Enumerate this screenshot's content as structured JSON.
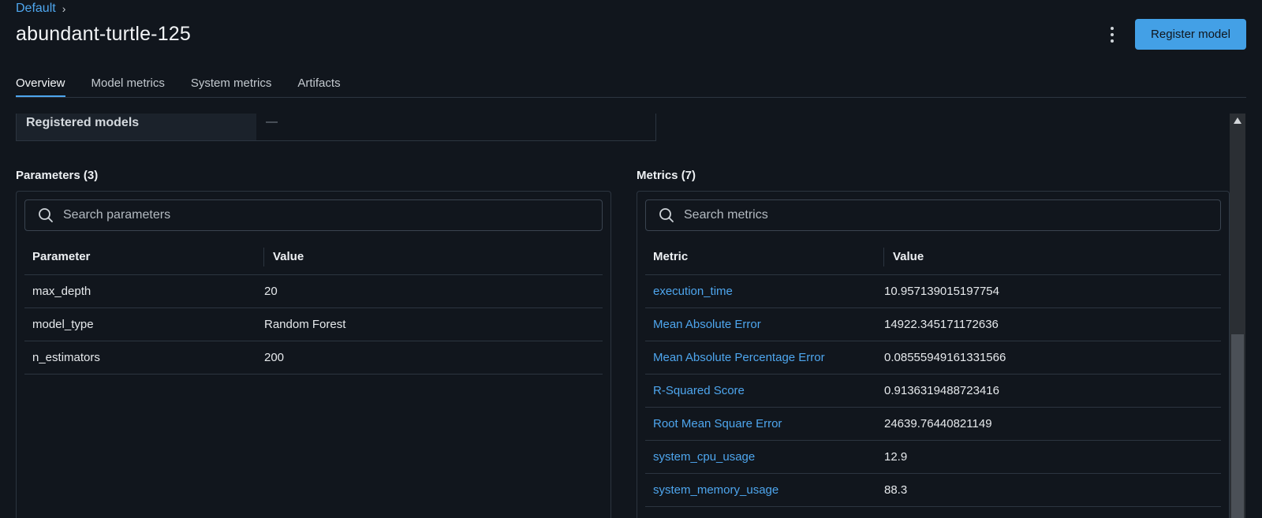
{
  "breadcrumb": {
    "link": "Default",
    "separator": "›"
  },
  "run_title": "abundant-turtle-125",
  "header": {
    "register_label": "Register model",
    "more_icon": "kebab-vertical-icon"
  },
  "tabs": [
    {
      "label": "Overview",
      "active": true
    },
    {
      "label": "Model metrics",
      "active": false
    },
    {
      "label": "System metrics",
      "active": false
    },
    {
      "label": "Artifacts",
      "active": false
    }
  ],
  "details": {
    "registered_models_label": "Registered models",
    "registered_models_value": "—"
  },
  "parameters": {
    "title": "Parameters (3)",
    "search_placeholder": "Search parameters",
    "col_name": "Parameter",
    "col_value": "Value",
    "rows": [
      {
        "name": "max_depth",
        "value": "20"
      },
      {
        "name": "model_type",
        "value": "Random Forest"
      },
      {
        "name": "n_estimators",
        "value": "200"
      }
    ]
  },
  "metrics": {
    "title": "Metrics (7)",
    "search_placeholder": "Search metrics",
    "col_name": "Metric",
    "col_value": "Value",
    "rows": [
      {
        "name": "execution_time",
        "value": "10.957139015197754"
      },
      {
        "name": "Mean Absolute Error",
        "value": "14922.345171172636"
      },
      {
        "name": "Mean Absolute Percentage Error",
        "value": "0.08555949161331566"
      },
      {
        "name": "R-Squared Score",
        "value": "0.9136319488723416"
      },
      {
        "name": "Root Mean Square Error",
        "value": "24639.76440821149"
      },
      {
        "name": "system_cpu_usage",
        "value": "12.9"
      },
      {
        "name": "system_memory_usage",
        "value": "88.3"
      }
    ]
  },
  "colors": {
    "background": "#11161d",
    "accent": "#4ea6ee",
    "button": "#43a0e6",
    "border": "#2c3540"
  }
}
